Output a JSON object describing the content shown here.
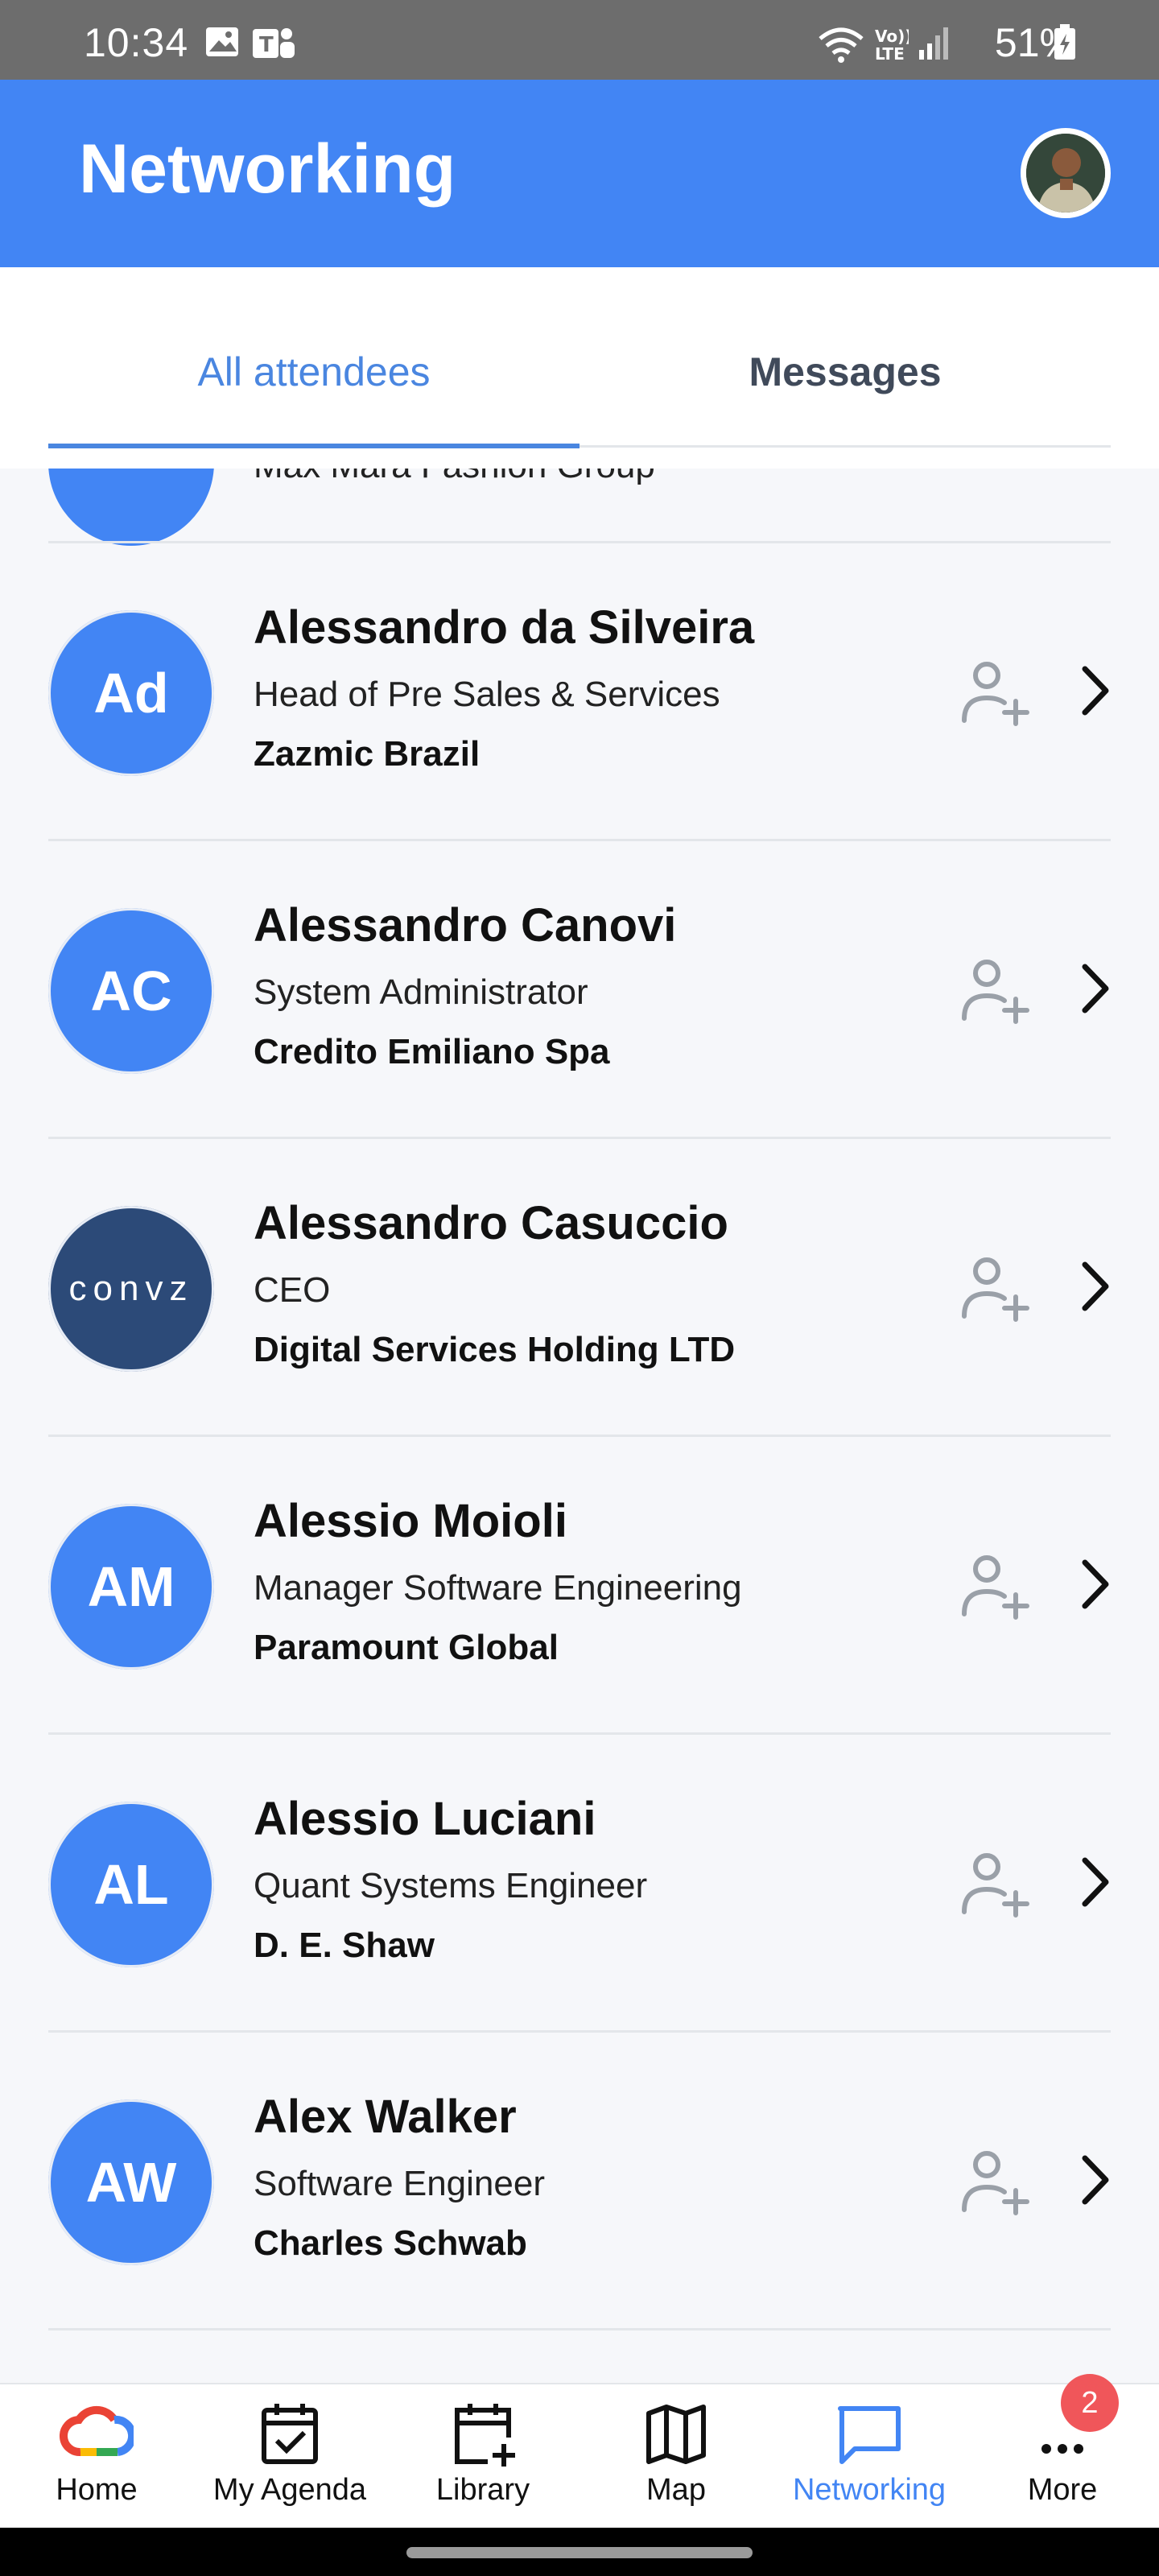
{
  "status_bar": {
    "time": "10:34",
    "battery": "51%"
  },
  "app_bar": {
    "title": "Networking"
  },
  "tabs": [
    {
      "label": "All attendees",
      "active": true
    },
    {
      "label": "Messages",
      "active": false
    }
  ],
  "list": {
    "partial_company": "Max Mara Fashion Group",
    "attendees": [
      {
        "initials": "Ad",
        "name": "Alessandro da Silveira",
        "title": "Head of Pre Sales & Services",
        "company": "Zazmic Brazil"
      },
      {
        "initials": "AC",
        "name": "Alessandro Canovi",
        "title": "System Administrator",
        "company": "Credito Emiliano Spa"
      },
      {
        "initials": "convz",
        "name": "Alessandro Casuccio",
        "title": "CEO",
        "company": "Digital Services Holding LTD"
      },
      {
        "initials": "AM",
        "name": "Alessio Moioli",
        "title": "Manager Software Engineering",
        "company": "Paramount Global"
      },
      {
        "initials": "AL",
        "name": "Alessio Luciani",
        "title": "Quant Systems Engineer",
        "company": "D. E. Shaw"
      },
      {
        "initials": "AW",
        "name": "Alex Walker",
        "title": "Software Engineer",
        "company": "Charles Schwab"
      }
    ]
  },
  "bottom_nav": {
    "items": [
      {
        "label": "Home",
        "icon": "google-cloud-icon"
      },
      {
        "label": "My Agenda",
        "icon": "calendar-check-icon"
      },
      {
        "label": "Library",
        "icon": "calendar-add-icon"
      },
      {
        "label": "Map",
        "icon": "map-icon"
      },
      {
        "label": "Networking",
        "icon": "chat-icon",
        "active": true
      },
      {
        "label": "More",
        "icon": "more-icon"
      }
    ],
    "more_badge": "2"
  },
  "colors": {
    "primary": "#4285f4",
    "badge": "#f0565a",
    "statusbar": "#6d6d6d"
  }
}
